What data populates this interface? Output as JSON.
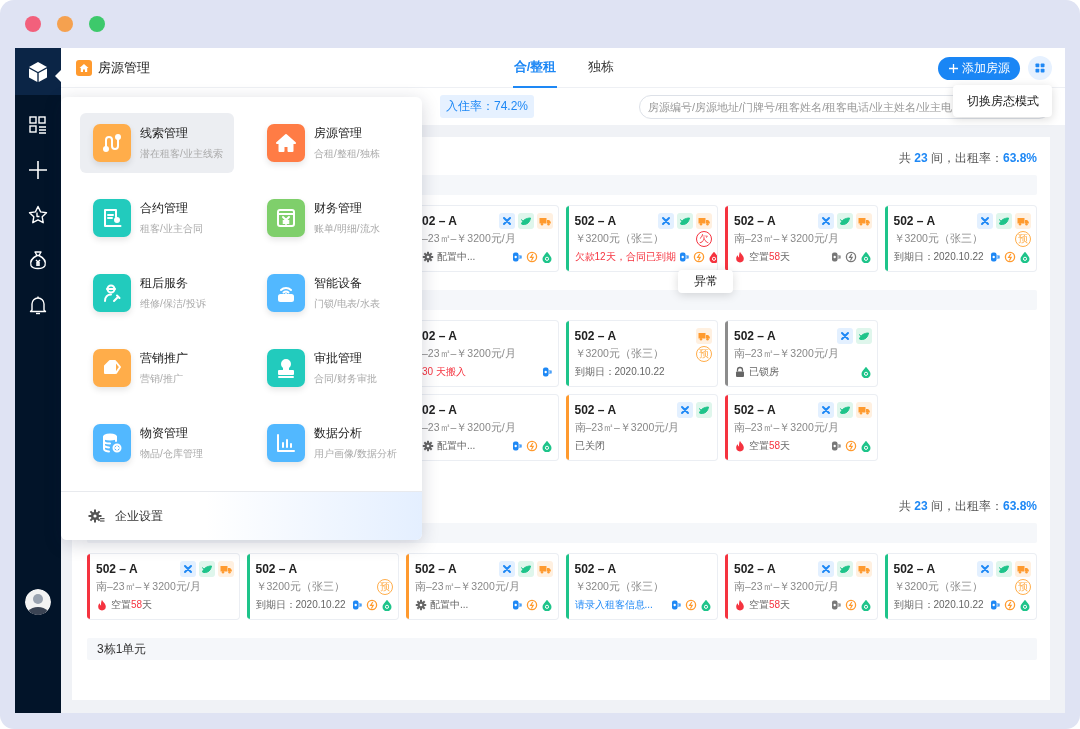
{
  "sidebar": {
    "items": [
      {
        "kind": "apps"
      },
      {
        "kind": "add"
      },
      {
        "kind": "star"
      },
      {
        "kind": "money"
      },
      {
        "kind": "bell"
      }
    ]
  },
  "header": {
    "title": "房源管理",
    "tabs": [
      {
        "label": "合/整租",
        "selected": true
      },
      {
        "label": "独栋",
        "selected": false
      }
    ],
    "add_button": "添加房源"
  },
  "filter_bar": {
    "occupancy": "入住率：74.2%",
    "search": {
      "placeholder": "房源编号/房源地址/门牌号/租客姓名/租客电话/业主姓名/业主电"
    }
  },
  "view_mode_tooltip": "切换房态模式",
  "menu": {
    "items": [
      {
        "kind": "route",
        "title": "线索管理",
        "subtitle": "潜在租客/业主线索",
        "color": "#ffad4a",
        "selected": true
      },
      {
        "kind": "house",
        "title": "房源管理",
        "subtitle": "合租/整租/独栋",
        "color": "#ff7c45",
        "selected": false
      },
      {
        "kind": "contract",
        "title": "合约管理",
        "subtitle": "租客/业主合同",
        "color": "#22cbbd",
        "selected": false
      },
      {
        "kind": "finance",
        "title": "财务管理",
        "subtitle": "账单/明细/流水",
        "color": "#7fcf6b",
        "selected": false
      },
      {
        "kind": "service",
        "title": "租后服务",
        "subtitle": "维修/保洁/投诉",
        "color": "#22cbbd",
        "selected": false
      },
      {
        "kind": "router",
        "title": "智能设备",
        "subtitle": "门锁/电表/水表",
        "color": "#52b8ff",
        "selected": false
      },
      {
        "kind": "tags",
        "title": "营销推广",
        "subtitle": "营销/推广",
        "color": "#ffad4a",
        "selected": false
      },
      {
        "kind": "stamp",
        "title": "审批管理",
        "subtitle": "合同/财务审批",
        "color": "#22cbbd",
        "selected": false
      },
      {
        "kind": "database",
        "title": "物资管理",
        "subtitle": "物品/仓库管理",
        "color": "#52b8ff",
        "selected": false
      },
      {
        "kind": "chart",
        "title": "数据分析",
        "subtitle": "用户画像/数据分析",
        "color": "#52b8ff",
        "selected": false
      }
    ],
    "footer": "企业设置"
  },
  "anomaly_tooltip": "异常",
  "panel": {
    "sections": [
      {
        "summary": {
          "prefix": "共",
          "count": "23",
          "unit": "间，出租率：",
          "rate": "63.8%"
        },
        "floors": [
          {
            "rows": [
              {
                "cards": [
                  {
                    "kind": "partial",
                    "title": "02 – A",
                    "tags": [
                      {
                        "kind": "tools"
                      },
                      {
                        "kind": "leaf"
                      },
                      {
                        "kind": "truck"
                      }
                    ],
                    "info": "–23㎡–￥3200元/月",
                    "status": {
                      "kind": "config",
                      "text": "配置中..."
                    },
                    "utilities": [
                      {
                        "kind": "lock",
                        "color": "#1e88f5"
                      },
                      {
                        "kind": "power",
                        "color": "#ff9a2e"
                      },
                      {
                        "kind": "water",
                        "color": "#1ec48a"
                      }
                    ]
                  },
                  {
                    "kind": "card",
                    "color": "#1ec48a",
                    "title": "502 – A",
                    "tags": [
                      {
                        "kind": "tools"
                      },
                      {
                        "kind": "leaf"
                      },
                      {
                        "kind": "truck"
                      }
                    ],
                    "info": "￥3200元（张三）",
                    "badge": {
                      "text": "欠",
                      "color": "#f5333f"
                    },
                    "status": {
                      "kind": "alert",
                      "text": "欠款12天，合同已到期"
                    },
                    "utilities": [
                      {
                        "kind": "lock",
                        "color": "#1e88f5"
                      },
                      {
                        "kind": "power",
                        "color": "#ff9a2e"
                      },
                      {
                        "kind": "water",
                        "color": "#f5333f"
                      }
                    ]
                  },
                  {
                    "kind": "card",
                    "color": "#f5333f",
                    "title": "502 – A",
                    "tags": [
                      {
                        "kind": "tools"
                      },
                      {
                        "kind": "leaf"
                      },
                      {
                        "kind": "truck"
                      }
                    ],
                    "info": "南–23㎡–￥3200元/月",
                    "status": {
                      "kind": "vacant",
                      "text": "空置",
                      "days": "58",
                      "unit": "天"
                    },
                    "utilities": [
                      {
                        "kind": "lock",
                        "color": "#777777"
                      },
                      {
                        "kind": "power",
                        "color": "#777777"
                      },
                      {
                        "kind": "water",
                        "color": "#1ec48a"
                      }
                    ]
                  },
                  {
                    "kind": "card",
                    "color": "#1ec48a",
                    "title": "502 – A",
                    "tags": [
                      {
                        "kind": "tools"
                      },
                      {
                        "kind": "leaf"
                      },
                      {
                        "kind": "truck"
                      }
                    ],
                    "info": "￥3200元（张三）",
                    "badge": {
                      "text": "预",
                      "color": "#ffad4a"
                    },
                    "status": {
                      "kind": "plain",
                      "text": "到期日：2020.10.22"
                    },
                    "utilities": [
                      {
                        "kind": "lock",
                        "color": "#1e88f5"
                      },
                      {
                        "kind": "power",
                        "color": "#ff9a2e"
                      },
                      {
                        "kind": "water",
                        "color": "#1ec48a"
                      }
                    ]
                  }
                ]
              }
            ]
          },
          {
            "rows": [
              {
                "cards": [
                  {
                    "kind": "partial",
                    "title": "02 – A",
                    "info": "–23㎡–￥3200元/月",
                    "status": {
                      "kind": "alert",
                      "text": "30 天搬入"
                    },
                    "utilities": [
                      {
                        "kind": "lock",
                        "color": "#1e88f5"
                      }
                    ]
                  },
                  {
                    "kind": "card",
                    "color": "#1ec48a",
                    "title": "502 – A",
                    "tags": [
                      {
                        "kind": "truck"
                      }
                    ],
                    "info": "￥3200元（张三）",
                    "badge": {
                      "text": "预",
                      "color": "#ffad4a"
                    },
                    "status": {
                      "kind": "plain",
                      "text": "到期日：2020.10.22"
                    }
                  },
                  {
                    "kind": "card",
                    "color": "#8c8c8c",
                    "title": "502 – A",
                    "tags": [
                      {
                        "kind": "tools"
                      },
                      {
                        "kind": "leaf"
                      }
                    ],
                    "info": "南–23㎡–￥3200元/月",
                    "status": {
                      "kind": "locked",
                      "text": "已锁房"
                    },
                    "utilities": [
                      {
                        "kind": "water",
                        "color": "#1ec48a"
                      }
                    ]
                  }
                ]
              },
              {
                "cards": [
                  {
                    "kind": "partial",
                    "title": "02 – A",
                    "info": "–23㎡–￥3200元/月",
                    "status": {
                      "kind": "config",
                      "text": "配置中..."
                    },
                    "utilities": [
                      {
                        "kind": "lock",
                        "color": "#1e88f5"
                      },
                      {
                        "kind": "power",
                        "color": "#ff9a2e"
                      },
                      {
                        "kind": "water",
                        "color": "#1ec48a"
                      }
                    ]
                  },
                  {
                    "kind": "card",
                    "color": "#ff9a2e",
                    "title": "502 – A",
                    "tags": [
                      {
                        "kind": "tools"
                      },
                      {
                        "kind": "leaf"
                      }
                    ],
                    "info": "南–23㎡–￥3200元/月",
                    "status": {
                      "kind": "plain",
                      "text": "已关闭"
                    }
                  },
                  {
                    "kind": "card",
                    "color": "#f5333f",
                    "title": "502 – A",
                    "tags": [
                      {
                        "kind": "tools"
                      },
                      {
                        "kind": "leaf"
                      },
                      {
                        "kind": "truck"
                      }
                    ],
                    "info": "南–23㎡–￥3200元/月",
                    "status": {
                      "kind": "vacant",
                      "text": "空置",
                      "days": "58",
                      "unit": "天"
                    },
                    "utilities": [
                      {
                        "kind": "lock",
                        "color": "#777777"
                      },
                      {
                        "kind": "power",
                        "color": "#ff9a2e"
                      },
                      {
                        "kind": "water",
                        "color": "#1ec48a"
                      }
                    ]
                  }
                ]
              }
            ]
          }
        ]
      },
      {
        "summary": {
          "prefix": "共",
          "count": "23",
          "unit": "间，出租率：",
          "rate": "63.8%"
        },
        "floors": [
          {
            "rows": [
              {
                "cards": [
                  {
                    "kind": "card",
                    "color": "#f5333f",
                    "title": "502 – A",
                    "tags": [
                      {
                        "kind": "tools"
                      },
                      {
                        "kind": "leaf"
                      },
                      {
                        "kind": "truck"
                      }
                    ],
                    "info": "南–23㎡–￥3200元/月",
                    "status": {
                      "kind": "vacant",
                      "text": "空置",
                      "days": "58",
                      "unit": "天"
                    }
                  },
                  {
                    "kind": "card",
                    "color": "#1ec48a",
                    "title": "502 – A",
                    "info": "￥3200元（张三）",
                    "badge": {
                      "text": "预",
                      "color": "#ffad4a"
                    },
                    "status": {
                      "kind": "plain",
                      "text": "到期日：2020.10.22"
                    },
                    "utilities": [
                      {
                        "kind": "lock",
                        "color": "#1e88f5"
                      },
                      {
                        "kind": "power",
                        "color": "#ff9a2e"
                      },
                      {
                        "kind": "water",
                        "color": "#1ec48a"
                      }
                    ]
                  },
                  {
                    "kind": "card",
                    "color": "#ff9a2e",
                    "title": "502 – A",
                    "tags": [
                      {
                        "kind": "tools"
                      },
                      {
                        "kind": "leaf"
                      },
                      {
                        "kind": "truck"
                      }
                    ],
                    "info": "南–23㎡–￥3200元/月",
                    "status": {
                      "kind": "config",
                      "text": "配置中..."
                    },
                    "utilities": [
                      {
                        "kind": "lock",
                        "color": "#1e88f5"
                      },
                      {
                        "kind": "power",
                        "color": "#ff9a2e"
                      },
                      {
                        "kind": "water",
                        "color": "#1ec48a"
                      }
                    ]
                  },
                  {
                    "kind": "card",
                    "color": "#1ec48a",
                    "title": "502 – A",
                    "info": "￥3200元（张三）",
                    "status": {
                      "kind": "link",
                      "text": "请录入租客信息..."
                    },
                    "utilities": [
                      {
                        "kind": "lock",
                        "color": "#1e88f5"
                      },
                      {
                        "kind": "power",
                        "color": "#ff9a2e"
                      },
                      {
                        "kind": "water",
                        "color": "#1ec48a"
                      }
                    ]
                  },
                  {
                    "kind": "card",
                    "color": "#f5333f",
                    "title": "502 – A",
                    "tags": [
                      {
                        "kind": "tools"
                      },
                      {
                        "kind": "leaf"
                      },
                      {
                        "kind": "truck"
                      }
                    ],
                    "info": "南–23㎡–￥3200元/月",
                    "status": {
                      "kind": "vacant",
                      "text": "空置",
                      "days": "58",
                      "unit": "天"
                    },
                    "utilities": [
                      {
                        "kind": "lock",
                        "color": "#777777"
                      },
                      {
                        "kind": "power",
                        "color": "#ff9a2e"
                      },
                      {
                        "kind": "water",
                        "color": "#1ec48a"
                      }
                    ]
                  },
                  {
                    "kind": "card",
                    "color": "#1ec48a",
                    "title": "502 – A",
                    "tags": [
                      {
                        "kind": "tools"
                      },
                      {
                        "kind": "leaf"
                      },
                      {
                        "kind": "truck"
                      }
                    ],
                    "info": "￥3200元（张三）",
                    "badge": {
                      "text": "预",
                      "color": "#ffad4a"
                    },
                    "status": {
                      "kind": "plain",
                      "text": "到期日：2020.10.22"
                    },
                    "utilities": [
                      {
                        "kind": "lock",
                        "color": "#1e88f5"
                      },
                      {
                        "kind": "power",
                        "color": "#ff9a2e"
                      },
                      {
                        "kind": "water",
                        "color": "#1ec48a"
                      }
                    ]
                  }
                ]
              }
            ]
          },
          {
            "label": "3栋1单元"
          }
        ]
      }
    ]
  }
}
